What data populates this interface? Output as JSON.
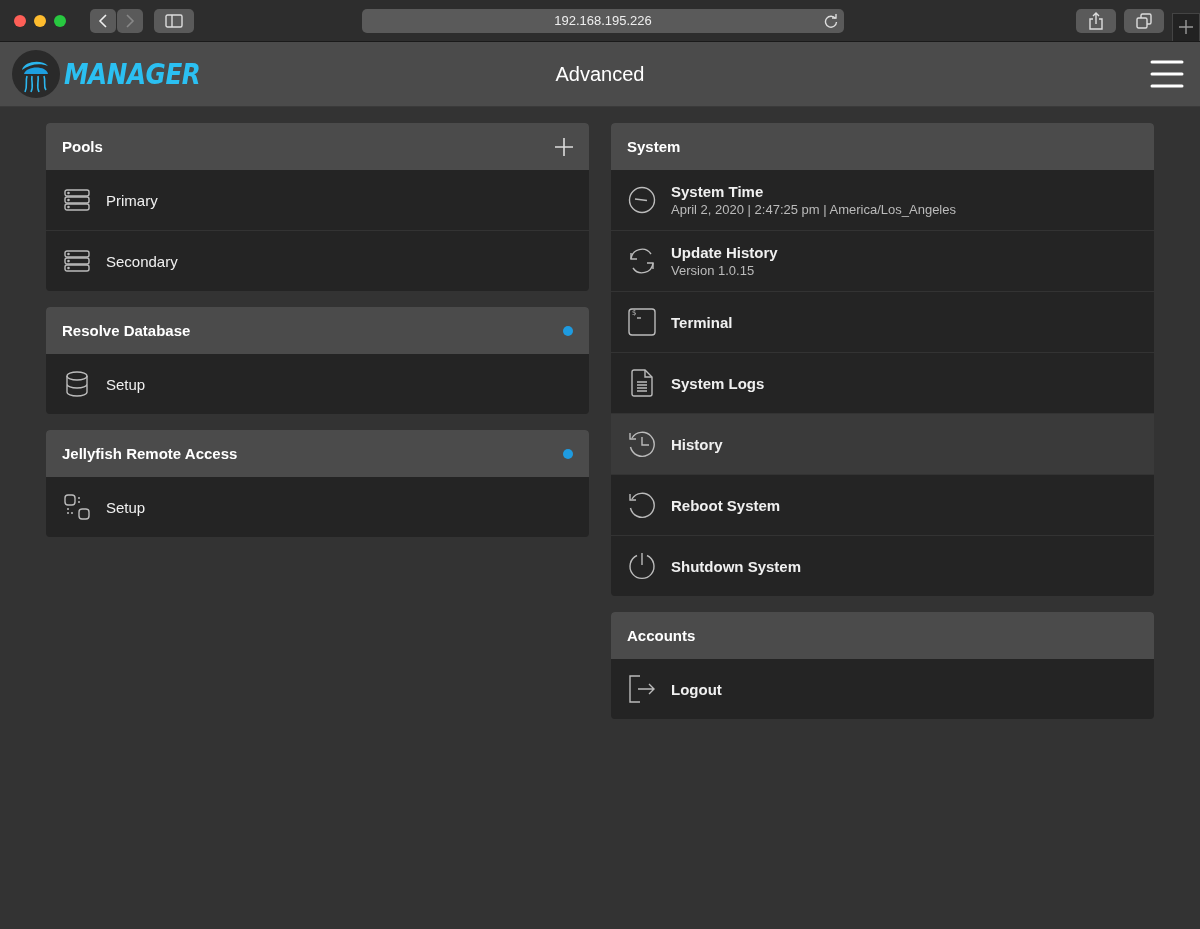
{
  "browser": {
    "address": "192.168.195.226"
  },
  "header": {
    "logo": "MANAGER",
    "title": "Advanced"
  },
  "left_panels": [
    {
      "title": "Pools",
      "add_button": true,
      "indicator": false,
      "items": [
        {
          "kind": "server",
          "label": "Primary"
        },
        {
          "kind": "server",
          "label": "Secondary"
        }
      ]
    },
    {
      "title": "Resolve Database",
      "add_button": false,
      "indicator": true,
      "items": [
        {
          "kind": "database",
          "label": "Setup"
        }
      ]
    },
    {
      "title": "Jellyfish Remote Access",
      "add_button": false,
      "indicator": true,
      "items": [
        {
          "kind": "remote",
          "label": "Setup"
        }
      ]
    }
  ],
  "right_panels": [
    {
      "title": "System",
      "items": [
        {
          "kind": "clock",
          "label": "System Time",
          "detail": "April 2, 2020 | 2:47:25 pm | America/Los_Angeles",
          "selected": false
        },
        {
          "kind": "sync",
          "label": "Update History",
          "detail": "Version 1.0.15",
          "selected": false
        },
        {
          "kind": "terminal",
          "glyph": "$",
          "label": "Terminal",
          "selected": false
        },
        {
          "kind": "document",
          "label": "System Logs",
          "selected": false
        },
        {
          "kind": "history",
          "label": "History",
          "selected": true
        },
        {
          "kind": "reboot",
          "label": "Reboot System",
          "selected": false
        },
        {
          "kind": "power",
          "label": "Shutdown System",
          "selected": false
        }
      ]
    },
    {
      "title": "Accounts",
      "items": [
        {
          "kind": "logout",
          "label": "Logout",
          "selected": false
        }
      ]
    }
  ]
}
